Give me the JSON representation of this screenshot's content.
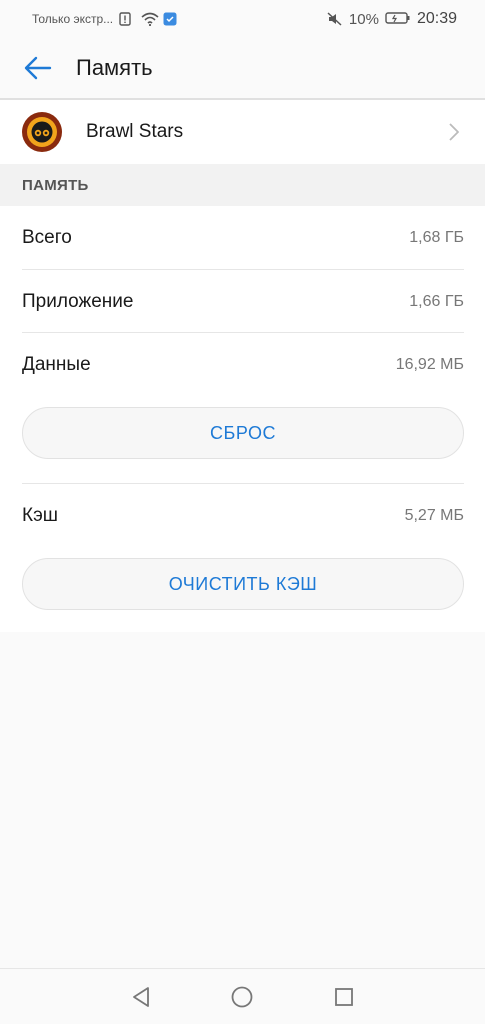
{
  "status_bar": {
    "carrier": "Только экстр...",
    "battery_pct": "10%",
    "time": "20:39"
  },
  "app_bar": {
    "title": "Память"
  },
  "app": {
    "name": "Brawl Stars"
  },
  "section": {
    "title": "ПАМЯТЬ"
  },
  "storage": {
    "total": {
      "label": "Всего",
      "value": "1,68 ГБ"
    },
    "app": {
      "label": "Приложение",
      "value": "1,66 ГБ"
    },
    "data": {
      "label": "Данные",
      "value": "16,92 МБ"
    },
    "reset_label": "СБРОС",
    "cache": {
      "label": "Кэш",
      "value": "5,27 МБ"
    },
    "clear_cache_label": "ОЧИСТИТЬ КЭШ"
  },
  "colors": {
    "accent": "#1e7ad6",
    "background": "#fafafa"
  }
}
